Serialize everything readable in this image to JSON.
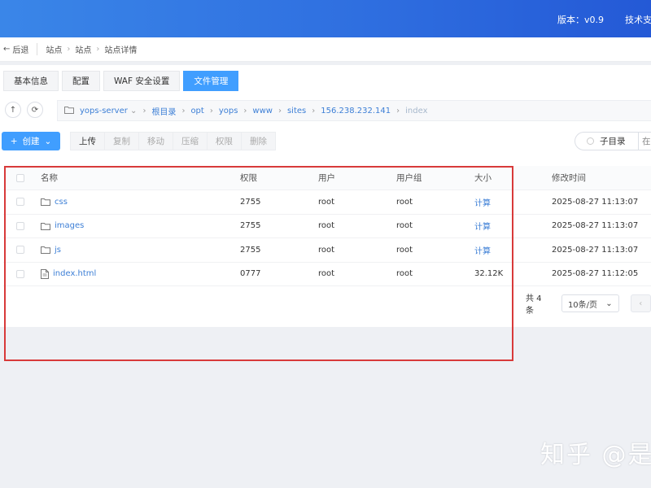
{
  "header": {
    "version": "版本：v0.9",
    "support": "技术支持"
  },
  "breadcrumb": {
    "back": "后退",
    "items": [
      "站点",
      "站点",
      "站点详情"
    ]
  },
  "tabs": [
    {
      "label": "基本信息",
      "active": false
    },
    {
      "label": "配置",
      "active": false
    },
    {
      "label": "WAF 安全设置",
      "active": false
    },
    {
      "label": "文件管理",
      "active": true
    }
  ],
  "path": {
    "root_host": "yops-server",
    "segments": [
      "根目录",
      "opt",
      "yops",
      "www",
      "sites",
      "156.238.232.141",
      "index"
    ]
  },
  "toolbar": {
    "create": "创建",
    "ops": [
      {
        "label": "上传",
        "enabled": true
      },
      {
        "label": "复制",
        "enabled": false
      },
      {
        "label": "移动",
        "enabled": false
      },
      {
        "label": "压缩",
        "enabled": false
      },
      {
        "label": "权限",
        "enabled": false
      },
      {
        "label": "删除",
        "enabled": false
      }
    ],
    "subdir_toggle": "子目录",
    "extra_toggle": "在"
  },
  "table": {
    "headers": {
      "name": "名称",
      "perm": "权限",
      "user": "用户",
      "group": "用户组",
      "size": "大小",
      "mtime": "修改时间"
    },
    "rows": [
      {
        "name": "css",
        "type": "folder",
        "perm": "2755",
        "user": "root",
        "group": "root",
        "size": "计算",
        "mtime": "2025-08-27 11:13:07"
      },
      {
        "name": "images",
        "type": "folder",
        "perm": "2755",
        "user": "root",
        "group": "root",
        "size": "计算",
        "mtime": "2025-08-27 11:13:07"
      },
      {
        "name": "js",
        "type": "folder",
        "perm": "2755",
        "user": "root",
        "group": "root",
        "size": "计算",
        "mtime": "2025-08-27 11:13:07"
      },
      {
        "name": "index.html",
        "type": "file",
        "perm": "0777",
        "user": "root",
        "group": "root",
        "size": "32.12K",
        "mtime": "2025-08-27 11:12:05"
      }
    ]
  },
  "pagination": {
    "total": "共 4 条",
    "page_size": "10条/页"
  },
  "watermark": "知乎 @是",
  "colors": {
    "accent": "#409eff",
    "header": "#2f6fe0",
    "highlight": "#d83a3a",
    "link": "#3d7fd6"
  }
}
